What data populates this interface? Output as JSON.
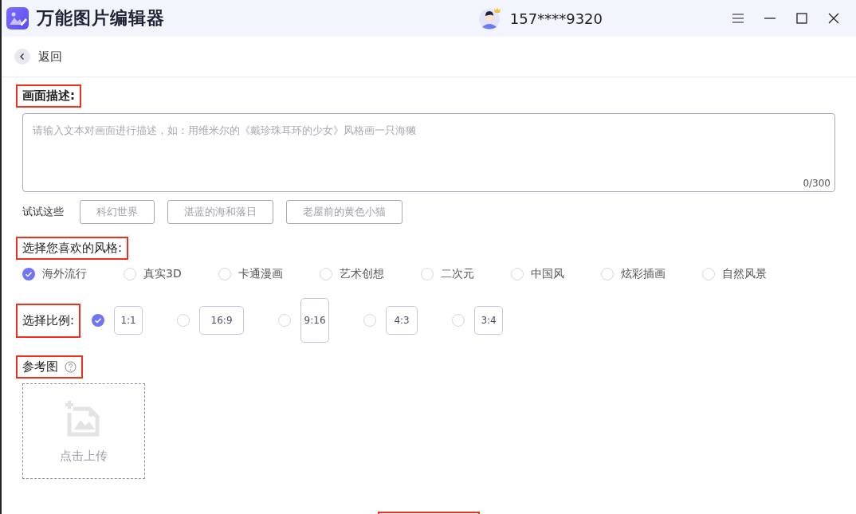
{
  "window": {
    "title": "万能图片编辑器",
    "user": "157****9320"
  },
  "back": {
    "label": "返回"
  },
  "description": {
    "label": "画面描述:",
    "highlighted": true,
    "placeholder": "请输入文本对画面进行描述，如：用维米尔的《戴珍珠耳环的少女》风格画一只海獭",
    "counter": "0/300"
  },
  "suggestions": {
    "label": "试试这些",
    "items": [
      "科幻世界",
      "湛蓝的海和落日",
      "老屋前的黄色小猫"
    ]
  },
  "styles": {
    "label": "选择您喜欢的风格:",
    "highlighted": true,
    "options": [
      {
        "label": "海外流行",
        "selected": true
      },
      {
        "label": "真实3D",
        "selected": false
      },
      {
        "label": "卡通漫画",
        "selected": false
      },
      {
        "label": "艺术创想",
        "selected": false
      },
      {
        "label": "二次元",
        "selected": false
      },
      {
        "label": "中国风",
        "selected": false
      },
      {
        "label": "炫彩插画",
        "selected": false
      },
      {
        "label": "自然风景",
        "selected": false
      }
    ]
  },
  "ratios": {
    "label": "选择比例:",
    "highlighted": true,
    "options": [
      {
        "label": "1:1",
        "kind": "square",
        "selected": true
      },
      {
        "label": "16:9",
        "kind": "wide",
        "selected": false
      },
      {
        "label": "9:16",
        "kind": "tall",
        "selected": false
      },
      {
        "label": "4:3",
        "kind": "landscape",
        "selected": false
      },
      {
        "label": "3:4",
        "kind": "portrait",
        "selected": false
      }
    ]
  },
  "reference": {
    "label": "参考图",
    "highlighted": true,
    "upload_label": "点击上传"
  }
}
